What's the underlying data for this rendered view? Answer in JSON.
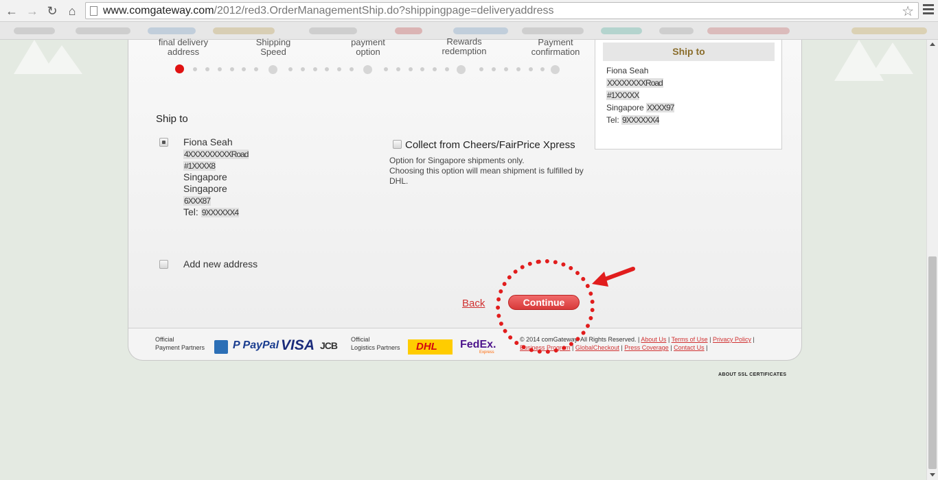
{
  "browser": {
    "url_host": "www.comgateway.com",
    "url_path": "/2012/red3.OrderManagementShip.do?shippingpage=deliveryaddress",
    "icons": [
      "back-arrow-icon",
      "forward-arrow-icon",
      "reload-icon",
      "home-icon",
      "star-icon",
      "menu-icon"
    ]
  },
  "steps": [
    {
      "line1": "final delivery",
      "line2": "address"
    },
    {
      "line1": "Shipping",
      "line2": "Speed"
    },
    {
      "line1": "payment",
      "line2": "option"
    },
    {
      "line1": "Rewards",
      "line2": "redemption"
    },
    {
      "line1": "Payment",
      "line2": "confirmation"
    }
  ],
  "ship_to": {
    "title": "Ship to",
    "address": {
      "name": "Fiona Seah",
      "line1": "4XXXXXXXXXRoad",
      "line2": "#1XXXX8",
      "city": "Singapore",
      "country": "Singapore",
      "postal": "6XXX87",
      "tel_label": "Tel:",
      "tel": "9XXXXXX4"
    },
    "collect_label": "Collect from Cheers/FairPrice Xpress",
    "collect_note_1": "Option for Singapore shipments only.",
    "collect_note_2": "Choosing this option will mean shipment is fulfilled by DHL.",
    "add_new": "Add new address"
  },
  "actions": {
    "back": "Back",
    "continue": "Continue"
  },
  "summary": {
    "title": "Ship to",
    "name": "Fiona Seah",
    "line1": "XXXXXXXXRoad",
    "line2": "#1XXXXX",
    "city_label": "Singapore",
    "postal": "XXXX97",
    "tel_label": "Tel:",
    "tel": "9XXXXXX4"
  },
  "footer": {
    "payment_partners_1": "Official",
    "payment_partners_2": "Payment Partners",
    "paypal": "PayPal",
    "visa": "VISA",
    "jcb": "JCB",
    "logistics_partners_1": "Official",
    "logistics_partners_2": "Logistics Partners",
    "dhl": "DHL",
    "fedex": "FedEx.",
    "fedex_sub": "Express",
    "copyright": "© 2014 comGateway. All Rights Reserved. |",
    "links": [
      "About Us",
      "Terms of Use",
      "Privacy Policy",
      "Business Program",
      "GlobalCheckout",
      "Press Coverage",
      "Contact Us"
    ],
    "ssl": "ABOUT SSL CERTIFICATES"
  },
  "colors": {
    "accent_red": "#e01212",
    "button_red": "#d83a3a",
    "summary_title": "#8a6d2c"
  }
}
